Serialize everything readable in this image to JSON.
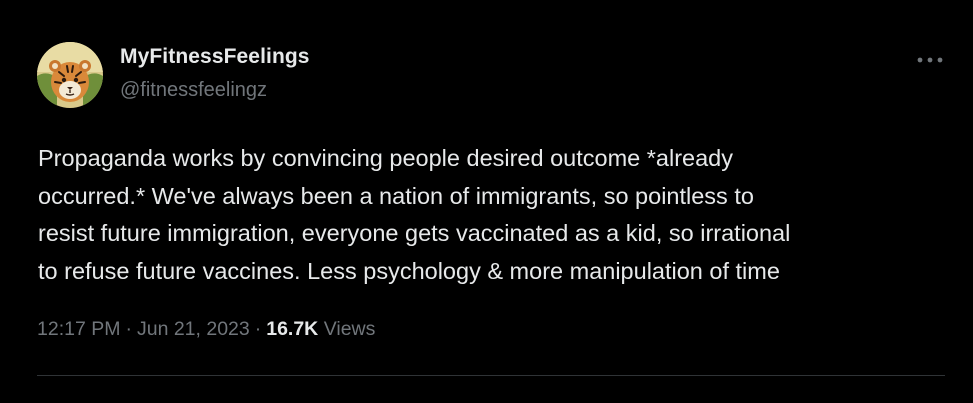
{
  "tweet": {
    "author": {
      "display_name": "MyFitnessFeelings",
      "handle": "@fitnessfeelingz",
      "avatar_icon": "tiger-avatar"
    },
    "more_icon": "more-horizontal-icon",
    "text_lines": [
      "Propaganda works by convincing people desired outcome *already",
      "occurred.* We've always been a nation of immigrants, so pointless to",
      "resist future immigration, everyone gets vaccinated as a kid, so irrational",
      "to refuse future vaccines. Less psychology & more manipulation of time"
    ],
    "meta": {
      "time": "12:17 PM",
      "separator": "·",
      "date": "Jun 21, 2023",
      "views_count": "16.7K",
      "views_label": "Views"
    }
  },
  "colors": {
    "background": "#000000",
    "primary_text": "#e7e9ea",
    "secondary_text": "#71767b",
    "divider": "#2f3336"
  }
}
